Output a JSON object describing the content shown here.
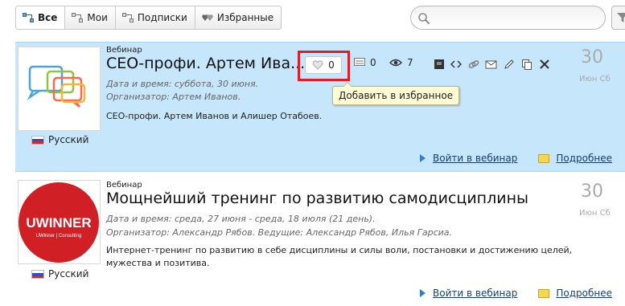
{
  "tabs": [
    {
      "label": "Все",
      "icon": "network-icon",
      "active": true
    },
    {
      "label": "Мои",
      "icon": "network-icon",
      "active": false
    },
    {
      "label": "Подписки",
      "icon": "network-icon",
      "active": false
    },
    {
      "label": "Избранные",
      "icon": "hearts-icon",
      "active": false
    }
  ],
  "search": {
    "placeholder": "",
    "icon": "search-icon"
  },
  "colors": {
    "highlight_bg": "#c6e6fb",
    "red_frame": "#e21c24",
    "tooltip_bg": "#fffbd3"
  },
  "events": [
    {
      "type": "Вебинар",
      "title": "СЕО-профи. Артем Ива...",
      "datetime": "Дата и время: суббота, 30 июня.",
      "organizer": "Организатор: Артем Иванов.",
      "description": "СЕО-профи. Артем Иванов и Алишер Отабоев.",
      "language": "Русский",
      "day": "30",
      "month_weekday": "Июн Сб",
      "join_label": "Войти в вебинар",
      "details_label": "Подробнее",
      "favorites_count": "0",
      "comments_count": "0",
      "views_count": "7",
      "tooltip": "Добавить в избранное",
      "highlighted": true
    },
    {
      "type": "Вебинар",
      "title": "Мощнейший тренинг по развитию самодисциплины",
      "datetime": "Дата и время: среда, 27 июня - среда, 18 июля (21 день).",
      "organizer": "Организатор: Александр Рябов. Ведущие: Александр Рябов, Илья Гарсиа.",
      "description": "Интернет-тренинг по развитию в себе дисциплины и силы воли, постановки и достижению целей, мужества и позитива.",
      "language": "Русский",
      "day": "30",
      "month_weekday": "Июн Сб",
      "join_label": "Войти в вебинар",
      "details_label": "Подробнее",
      "logo_text_main": "UWINNER",
      "logo_text_sub": "UWinner | Consulting",
      "highlighted": false
    }
  ]
}
